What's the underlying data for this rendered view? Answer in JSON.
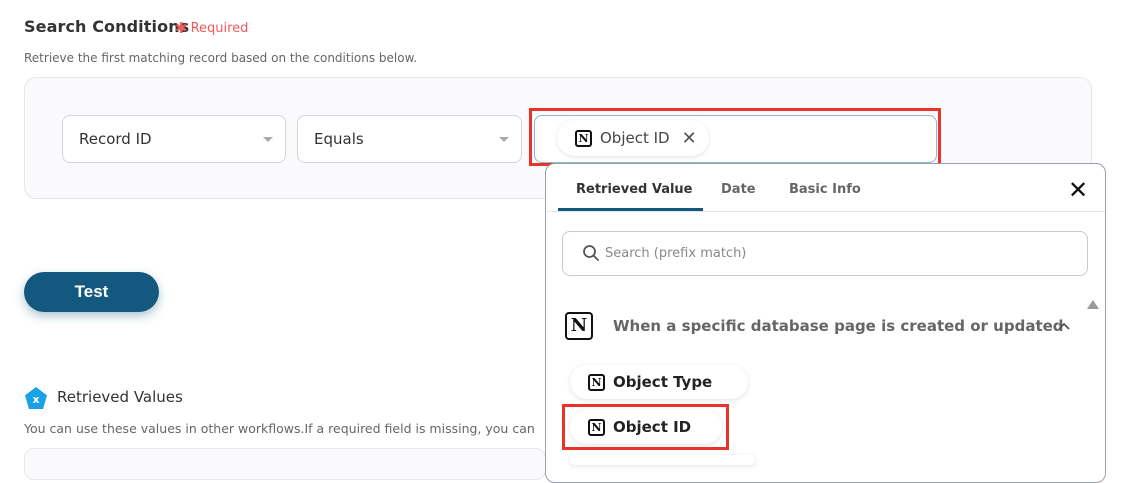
{
  "search_conditions": {
    "title": "Search Conditions",
    "required_label": "Required",
    "description": "Retrieve the first matching record based on the conditions below.",
    "field_select": {
      "value": "Record ID"
    },
    "operator_select": {
      "value": "Equals"
    },
    "value_chip": {
      "label": "Object ID",
      "icon": "notion-logo-icon"
    }
  },
  "test_button": {
    "label": "Test"
  },
  "retrieved_values": {
    "title": "Retrieved Values",
    "description": "You can use these values in other workflows.If a required field is missing, you can"
  },
  "dropdown": {
    "tabs": [
      {
        "label": "Retrieved Value",
        "active": true
      },
      {
        "label": "Date",
        "active": false
      },
      {
        "label": "Basic Info",
        "active": false
      }
    ],
    "search": {
      "placeholder": "Search (prefix match)"
    },
    "group": {
      "title": "When a specific database page is created or updated",
      "expanded": true,
      "items": [
        {
          "label": "Object Type"
        },
        {
          "label": "Object ID"
        }
      ]
    }
  },
  "colors": {
    "accent": "#14587f",
    "highlight": "#e8332a",
    "required": "#f05a5a",
    "retrieved_icon": "#1aa1e8"
  }
}
